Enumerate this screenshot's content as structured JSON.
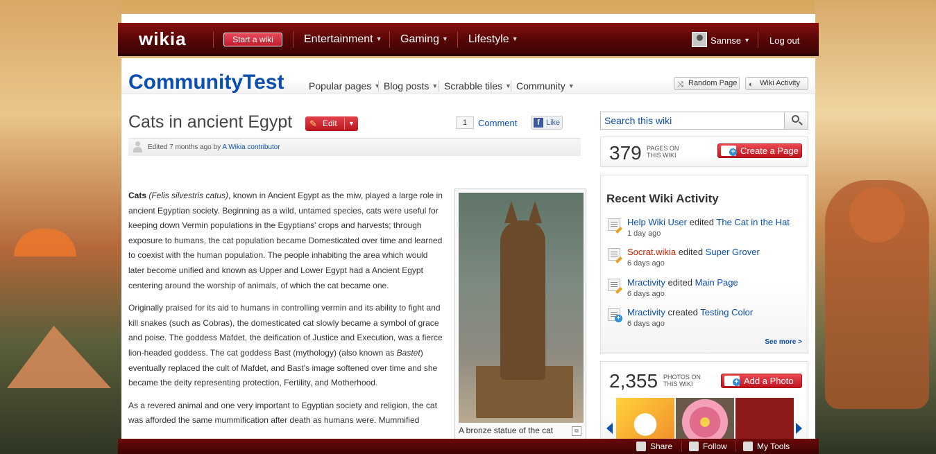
{
  "global_nav": {
    "logo": "wikia",
    "start_wiki": "Start a wiki",
    "items": [
      {
        "label": "Entertainment"
      },
      {
        "label": "Gaming"
      },
      {
        "label": "Lifestyle"
      }
    ],
    "user_name": "Sannse",
    "logout": "Log out"
  },
  "wiki_header": {
    "title": "CommunityTest",
    "nav": [
      {
        "label": "Popular pages"
      },
      {
        "label": "Blog posts"
      },
      {
        "label": "Scrabble tiles"
      },
      {
        "label": "Community"
      }
    ],
    "random_page": "Random Page",
    "wiki_activity": "Wiki Activity"
  },
  "article": {
    "title": "Cats in ancient Egypt",
    "edit_label": "Edit",
    "comment_count": "1",
    "comment_label": "Comment",
    "like_label": "Like",
    "edited_prefix": "Edited 7 months ago by",
    "edited_by": "A Wikia contributor",
    "p1_bold": "Cats",
    "p1_italic": "(Felis silvestris catus)",
    "p1_rest": ", known in Ancient Egypt as the miw, played a large role in ancient Egyptian society. Beginning as a wild, untamed species, cats were useful for keeping down Vermin populations in the Egyptians' crops and harvests; through exposure to humans, the cat population became Domesticated over time and learned to coexist with the human population. The people inhabiting the area which would later become unified and known as Upper and Lower Egypt had a Ancient Egypt centering around the worship of animals, of which the cat became one.",
    "p2_start": "Originally praised for its aid to humans in controlling vermin and its ability to fight and kill snakes (such as Cobras), the domesticated cat slowly became a symbol of grace and poise. The goddess Mafdet, the deification of Justice and Execution, was a fierce lion-headed goddess. The cat goddess Bast (mythology) (also known as ",
    "p2_italic": "Bastet",
    "p2_end": ") eventually replaced the cult of Mafdet, and Bast's image softened over time and she became the deity representing protection, Fertility, and Motherhood.",
    "p3": "As a revered animal and one very important to Egyptian society and religion, the cat was afforded the same mummification after death as humans were. Mummified",
    "thumb_caption": "A bronze statue of the cat"
  },
  "rail": {
    "search_placeholder": "Search this wiki",
    "pages_count": "379",
    "pages_label_1": "PAGES ON",
    "pages_label_2": "THIS WIKI",
    "create_page": "Create a Page",
    "rwa_title": "Recent Wiki Activity",
    "activity": [
      {
        "user": "Help Wiki User",
        "action": "edited",
        "page": "The Cat in the Hat",
        "time": "1 day ago"
      },
      {
        "user": "Socrat.wikia",
        "action": "edited",
        "page": "Super Grover",
        "time": "6 days ago"
      },
      {
        "user": "Mractivity",
        "action": "edited",
        "page": "Main Page",
        "time": "6 days ago"
      },
      {
        "user": "Mractivity",
        "action": "created",
        "page": "Testing Color",
        "time": "6 days ago"
      }
    ],
    "see_more": "See more >",
    "photos_count": "2,355",
    "photos_label_1": "PHOTOS ON",
    "photos_label_2": "THIS WIKI",
    "add_photo": "Add a Photo"
  },
  "toolbar": {
    "share": "Share",
    "follow": "Follow",
    "my_tools": "My Tools"
  },
  "colors": {
    "brand_red": "#8b0f0f",
    "link_blue": "#0b4fb0",
    "accent_red_button": "#c0131f"
  }
}
